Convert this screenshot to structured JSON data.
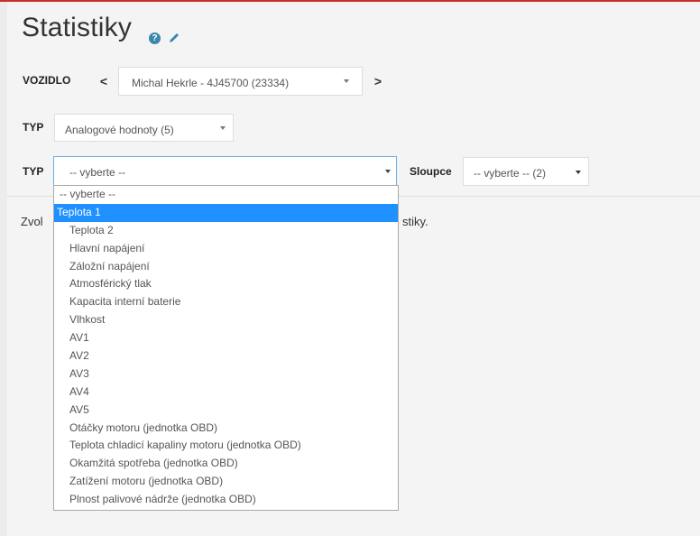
{
  "page": {
    "title": "Statistiky"
  },
  "vehicle": {
    "label": "VOZIDLO",
    "prev": "<",
    "next": ">",
    "selected": "Michal Hekrle - 4J45700 (23334)"
  },
  "type_filter": {
    "label": "TYP",
    "selected": "Analogové hodnoty (5)"
  },
  "type_select": {
    "label": "TYP",
    "placeholder": "-- vyberte --"
  },
  "columns": {
    "label": "Sloupce",
    "selected": "-- vyberte -- (2)"
  },
  "message": {
    "left": "Zvol",
    "right": "stiky."
  },
  "dropdown": {
    "options": [
      "-- vyberte --",
      "Teplota 1",
      "Teplota 2",
      "Hlavní napájení",
      "Záložní napájení",
      "Atmosférický tlak",
      "Kapacita interní baterie",
      "Vlhkost",
      "AV1",
      "AV2",
      "AV3",
      "AV4",
      "AV5",
      "Otáčky motoru (jednotka OBD)",
      "Teplota chladicí kapaliny motoru (jednotka OBD)",
      "Okamžitá spotřeba (jednotka OBD)",
      "Zatížení motoru (jednotka OBD)",
      "Plnost palivové nádrže (jednotka OBD)"
    ],
    "highlighted_index": 1
  },
  "colors": {
    "accent": "#c9302c",
    "highlight": "#1e90ff",
    "info_icon": "#3a87ad"
  }
}
